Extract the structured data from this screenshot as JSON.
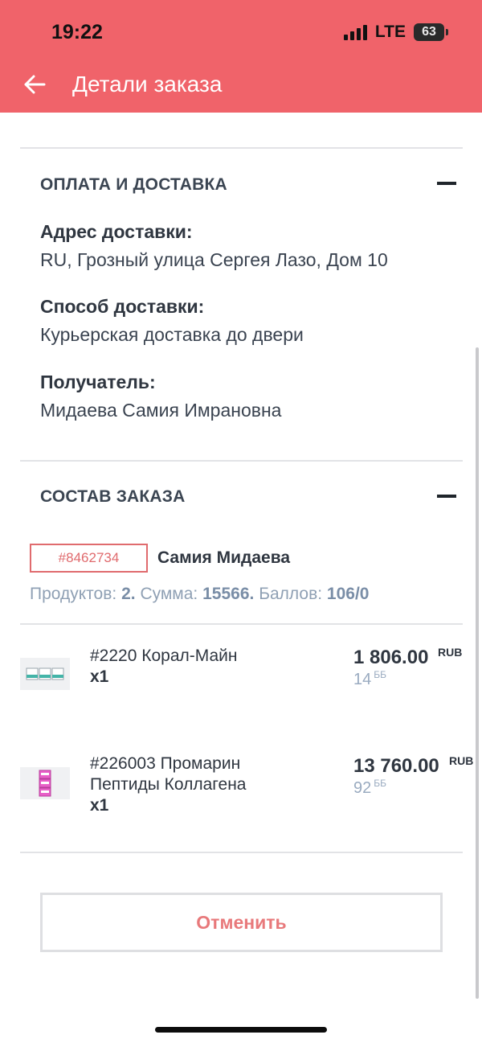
{
  "status_bar": {
    "time": "19:22",
    "network": "LTE",
    "battery": "63"
  },
  "header": {
    "title": "Детали заказа"
  },
  "payment_delivery": {
    "title": "ОПЛАТА И ДОСТАВКА",
    "address_label": "Адрес доставки:",
    "address_value": "RU, Грозный улица Сергея Лазо, Дом 10",
    "method_label": "Способ доставки:",
    "method_value": "Курьерская доставка до двери",
    "recipient_label": "Получатель:",
    "recipient_value": "Мидаева Самия Имрановна"
  },
  "order_contents": {
    "title": "СОСТАВ ЗАКАЗА",
    "order_id": "#8462734",
    "customer": "Самия Мидаева",
    "products_label": "Продуктов:",
    "products_value": "2.",
    "sum_label": "Сумма:",
    "sum_value": "15566.",
    "points_label": "Баллов:",
    "points_value": "106/0",
    "items": [
      {
        "name": "#2220 Корал-Майн",
        "qty": "x1",
        "price": "1 806.00",
        "currency": "RUB",
        "points": "14",
        "points_unit": "ББ",
        "thumb_icon": "product-boxes-blue-icon"
      },
      {
        "name": "#226003 Промарин Пептиды Коллагена",
        "qty": "x1",
        "price": "13 760.00",
        "currency": "RUB",
        "points": "92",
        "points_unit": "ББ",
        "thumb_icon": "product-boxes-pink-icon"
      }
    ]
  },
  "actions": {
    "cancel_label": "Отменить"
  },
  "colors": {
    "header_bg": "#f0636a",
    "accent": "#e06b6e",
    "muted": "#8fa0b4"
  }
}
